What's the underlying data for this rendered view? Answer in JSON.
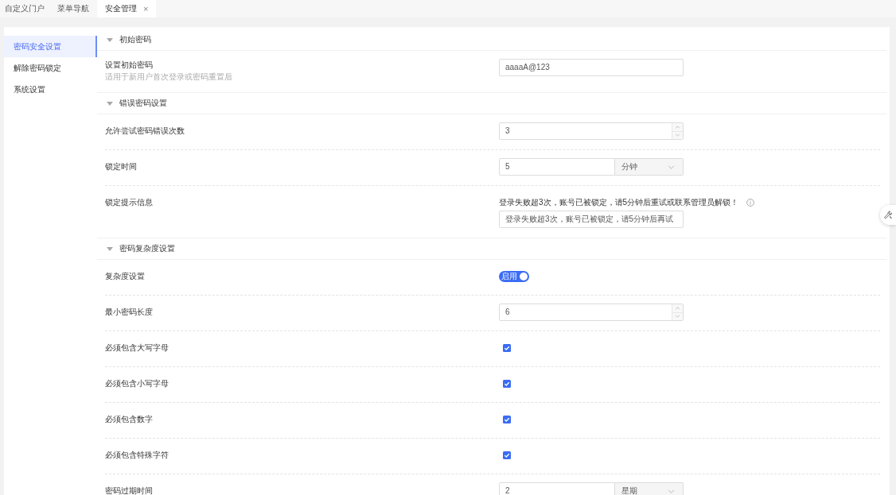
{
  "tabs": [
    {
      "label": "自定义门户",
      "selected": false
    },
    {
      "label": "菜单导航",
      "selected": false
    },
    {
      "label": "安全管理",
      "selected": true,
      "close": "×"
    }
  ],
  "sidebar": [
    {
      "label": "密码安全设置",
      "selected": true
    },
    {
      "label": "解除密码锁定",
      "selected": false
    },
    {
      "label": "系统设置",
      "selected": false
    }
  ],
  "sections": [
    {
      "title": "初始密码",
      "expanded": true,
      "rows": [
        {
          "kind": "text",
          "label": "设置初始密码",
          "hint": "适用于新用户首次登录或密码重置后",
          "value": "aaaaA@123"
        }
      ]
    },
    {
      "title": "错误密码设置",
      "expanded": true,
      "rows": [
        {
          "kind": "number",
          "label": "允许尝试密码错误次数",
          "value": "3"
        },
        {
          "kind": "unit",
          "label": "锁定时间",
          "value": "5",
          "unit": "分钟"
        },
        {
          "kind": "message",
          "label": "锁定提示信息",
          "note": "登录失败超3次，账号已被锁定，请5分钟后重试或联系管理员解锁！",
          "value": "登录失败超3次，账号已被锁定，请5分钟后再试"
        }
      ]
    },
    {
      "title": "密码复杂度设置",
      "expanded": true,
      "rows": [
        {
          "kind": "switch",
          "label": "复杂度设置",
          "on": true,
          "switch_text": "启用"
        },
        {
          "kind": "number",
          "label": "最小密码长度",
          "value": "6"
        },
        {
          "kind": "checkbox",
          "label": "必须包含大写字母",
          "checked": true
        },
        {
          "kind": "checkbox",
          "label": "必须包含小写字母",
          "checked": true
        },
        {
          "kind": "checkbox",
          "label": "必须包含数字",
          "checked": true
        },
        {
          "kind": "checkbox",
          "label": "必须包含特殊字符",
          "checked": true
        },
        {
          "kind": "unit",
          "label": "密码过期时间",
          "value": "2",
          "unit": "星期"
        }
      ]
    }
  ]
}
